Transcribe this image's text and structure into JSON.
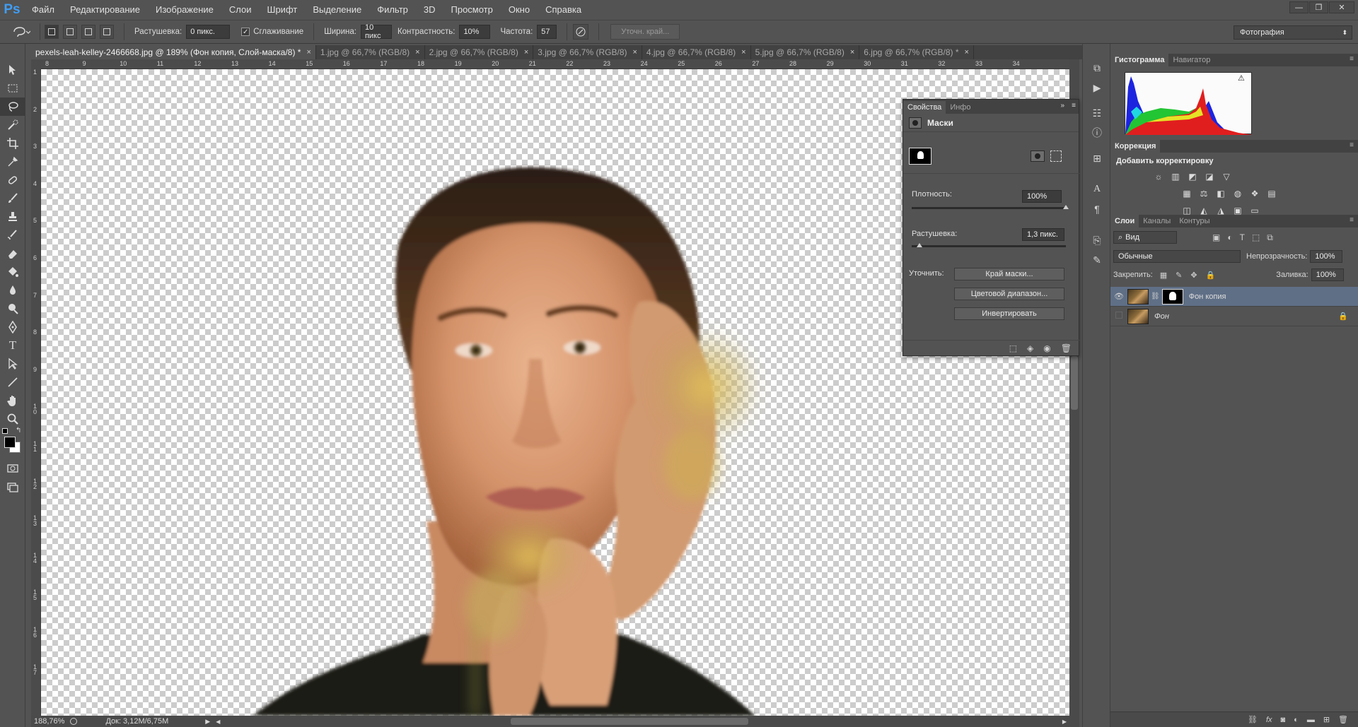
{
  "app": {
    "logo": "Ps"
  },
  "menu": [
    "Файл",
    "Редактирование",
    "Изображение",
    "Слои",
    "Шрифт",
    "Выделение",
    "Фильтр",
    "3D",
    "Просмотр",
    "Окно",
    "Справка"
  ],
  "window_controls": {
    "minimize": "—",
    "restore": "❐",
    "close": "✕"
  },
  "options": {
    "feather_label": "Растушевка:",
    "feather_value": "0 пикс.",
    "antialias_label": "Сглаживание",
    "antialias_checked": "✓",
    "width_label": "Ширина:",
    "width_value": "10 пикс",
    "contrast_label": "Контрастность:",
    "contrast_value": "10%",
    "frequency_label": "Частота:",
    "frequency_value": "57",
    "refine_edge": "Уточн. край...",
    "workspace": "Фотография"
  },
  "tabs": [
    {
      "label": "pexels-leah-kelley-2466668.jpg @ 189% (Фон копия, Слой-маска/8) *",
      "close": "×"
    },
    {
      "label": "1.jpg @ 66,7% (RGB/8)",
      "close": "×"
    },
    {
      "label": "2.jpg @ 66,7% (RGB/8)",
      "close": "×"
    },
    {
      "label": "3.jpg @ 66,7% (RGB/8)",
      "close": "×"
    },
    {
      "label": "4.jpg @ 66,7% (RGB/8)",
      "close": "×"
    },
    {
      "label": "5.jpg @ 66,7% (RGB/8)",
      "close": "×"
    },
    {
      "label": "6.jpg @ 66,7% (RGB/8) *",
      "close": "×"
    }
  ],
  "ruler": {
    "top": [
      "8",
      "9",
      "10",
      "11",
      "12",
      "13",
      "14",
      "15",
      "16",
      "17",
      "18",
      "19",
      "20",
      "21",
      "22",
      "23",
      "24",
      "25",
      "26",
      "27",
      "28",
      "29",
      "30",
      "31",
      "32",
      "33",
      "34"
    ],
    "left": [
      "1",
      "2",
      "3",
      "4",
      "5",
      "6",
      "7",
      "8",
      "9",
      "1 0",
      "1 1",
      "1 2",
      "1 3",
      "1 4",
      "1 5",
      "1 6",
      "1 7"
    ]
  },
  "status": {
    "zoom": "188,76%",
    "doc": "Док: 3,12M/6,75M"
  },
  "properties": {
    "tabs": [
      "Свойства",
      "Инфо"
    ],
    "title": "Маски",
    "density_label": "Плотность:",
    "density_value": "100%",
    "density_level": 1.0,
    "feather_label": "Растушевка:",
    "feather_value": "1,3 пикс.",
    "feather_level": 0.05,
    "refine_label": "Уточнить:",
    "btn_mask_edge": "Край маски...",
    "btn_color_range": "Цветовой диапазон...",
    "btn_invert": "Инвертировать"
  },
  "histogram": {
    "tabs": [
      "Гистограмма",
      "Навигатор"
    ],
    "warning": "⚠"
  },
  "adjustments": {
    "tab": "Коррекция",
    "title": "Добавить корректировку"
  },
  "layers": {
    "tabs": [
      "Слои",
      "Каналы",
      "Контуры"
    ],
    "filter": "Вид",
    "blend": "Обычные",
    "opacity_label": "Непрозрачность:",
    "opacity_value": "100%",
    "lock_label": "Закрепить:",
    "fill_label": "Заливка:",
    "fill_value": "100%",
    "items": [
      {
        "name": "Фон копия",
        "visible": true,
        "selected": true
      },
      {
        "name": "Фон",
        "visible": false,
        "selected": false
      }
    ]
  },
  "colors": {
    "accent": "#3f9ef5",
    "selected_layer": "#5f6f86",
    "panel": "#535353"
  }
}
